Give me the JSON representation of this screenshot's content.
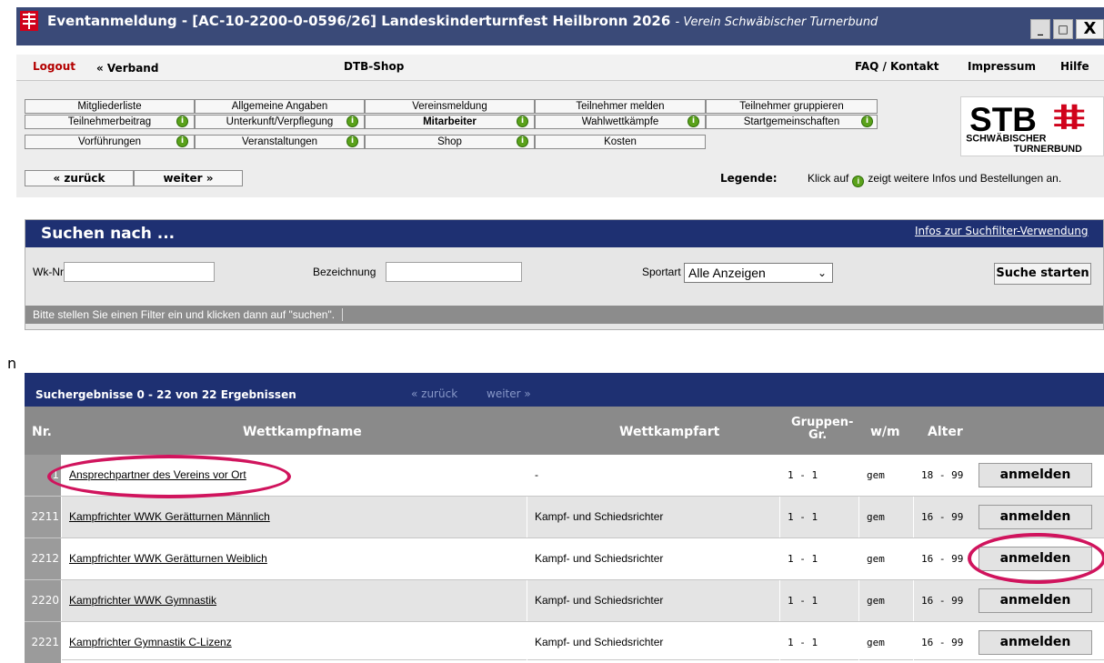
{
  "window": {
    "title": "Eventanmeldung - [AC-10-2200-0-0596/26] Landeskinderturnfest Heilbronn 2026",
    "subtitle": "- Verein Schwäbischer Turnerbund",
    "min": "_",
    "max": "□",
    "close": "X"
  },
  "nav": {
    "logout": "Logout",
    "verband": "« Verband",
    "dtb_shop": "DTB-Shop",
    "faq": "FAQ / Kontakt",
    "impressum": "Impressum",
    "hilfe": "Hilfe"
  },
  "menu": [
    {
      "label": "Mitgliederliste",
      "info": false,
      "bold": false
    },
    {
      "label": "Allgemeine Angaben",
      "info": false,
      "bold": false
    },
    {
      "label": "Vereinsmeldung",
      "info": false,
      "bold": false
    },
    {
      "label": "Teilnehmer melden",
      "info": false,
      "bold": false
    },
    {
      "label": "Teilnehmer gruppieren",
      "info": false,
      "bold": false
    },
    {
      "label": "Teilnehmerbeitrag",
      "info": true,
      "bold": false
    },
    {
      "label": "Unterkunft/Verpflegung",
      "info": true,
      "bold": false
    },
    {
      "label": "Mitarbeiter",
      "info": true,
      "bold": true
    },
    {
      "label": "Wahlwettkämpfe",
      "info": true,
      "bold": false
    },
    {
      "label": "Startgemeinschaften",
      "info": true,
      "bold": false
    },
    {
      "label": "Vorführungen",
      "info": true,
      "bold": false
    },
    {
      "label": "Veranstaltungen",
      "info": true,
      "bold": false
    },
    {
      "label": "Shop",
      "info": true,
      "bold": false
    },
    {
      "label": "Kosten",
      "info": false,
      "bold": false
    }
  ],
  "pager": {
    "back": "« zurück",
    "next": "weiter »"
  },
  "legend": {
    "label": "Legende:",
    "text_before": "Klick auf",
    "text_after": "zeigt weitere Infos und Bestellungen an."
  },
  "logo": {
    "big": "STB",
    "line1": "SCHWÄBISCHER",
    "line2": "TURNERBUND"
  },
  "search": {
    "title": "Suchen nach ...",
    "info_link": "Infos zur Suchfilter-Verwendung",
    "wk_label": "Wk-Nr.",
    "wk_value": "",
    "bez_label": "Bezeichnung",
    "bez_value": "",
    "sport_label": "Sportart",
    "sport_value": "Alle Anzeigen",
    "start_button": "Suche starten",
    "status": "Bitte stellen Sie einen Filter ein und klicken dann auf \"suchen\"."
  },
  "left_mark": "n",
  "results": {
    "title": "Suchergebnisse 0 - 22 von 22 Ergebnissen",
    "back": "« zurück",
    "next": "weiter »",
    "columns": {
      "nr": "Nr.",
      "name": "Wettkampfname",
      "art": "Wettkampfart",
      "gruppe_1": "Gruppen-",
      "gruppe_2": "Gr.",
      "wm": "w/m",
      "alter": "Alter"
    },
    "register_label": "anmelden",
    "rows": [
      {
        "nr": "1",
        "name": "Ansprechpartner des Vereins vor Ort",
        "art": "-",
        "gruppe": "1 - 1",
        "wm": "gem",
        "alter": "18 - 99"
      },
      {
        "nr": "2211",
        "name": "Kampfrichter WWK Gerätturnen Männlich",
        "art": "Kampf- und Schiedsrichter",
        "gruppe": "1 - 1",
        "wm": "gem",
        "alter": "16 - 99"
      },
      {
        "nr": "2212",
        "name": "Kampfrichter WWK Gerätturnen Weiblich",
        "art": "Kampf- und Schiedsrichter",
        "gruppe": "1 - 1",
        "wm": "gem",
        "alter": "16 - 99"
      },
      {
        "nr": "2220",
        "name": "Kampfrichter WWK Gymnastik",
        "art": "Kampf- und Schiedsrichter",
        "gruppe": "1 - 1",
        "wm": "gem",
        "alter": "16 - 99"
      },
      {
        "nr": "2221",
        "name": "Kampfrichter Gymnastik C-Lizenz",
        "art": "Kampf- und Schiedsrichter",
        "gruppe": "1 - 1",
        "wm": "gem",
        "alter": "16 - 99"
      }
    ]
  },
  "colors": {
    "header_blue": "#1e3072",
    "highlight": "#d0145d",
    "info_green": "#5aa21a",
    "logo_red": "#d0021b"
  }
}
